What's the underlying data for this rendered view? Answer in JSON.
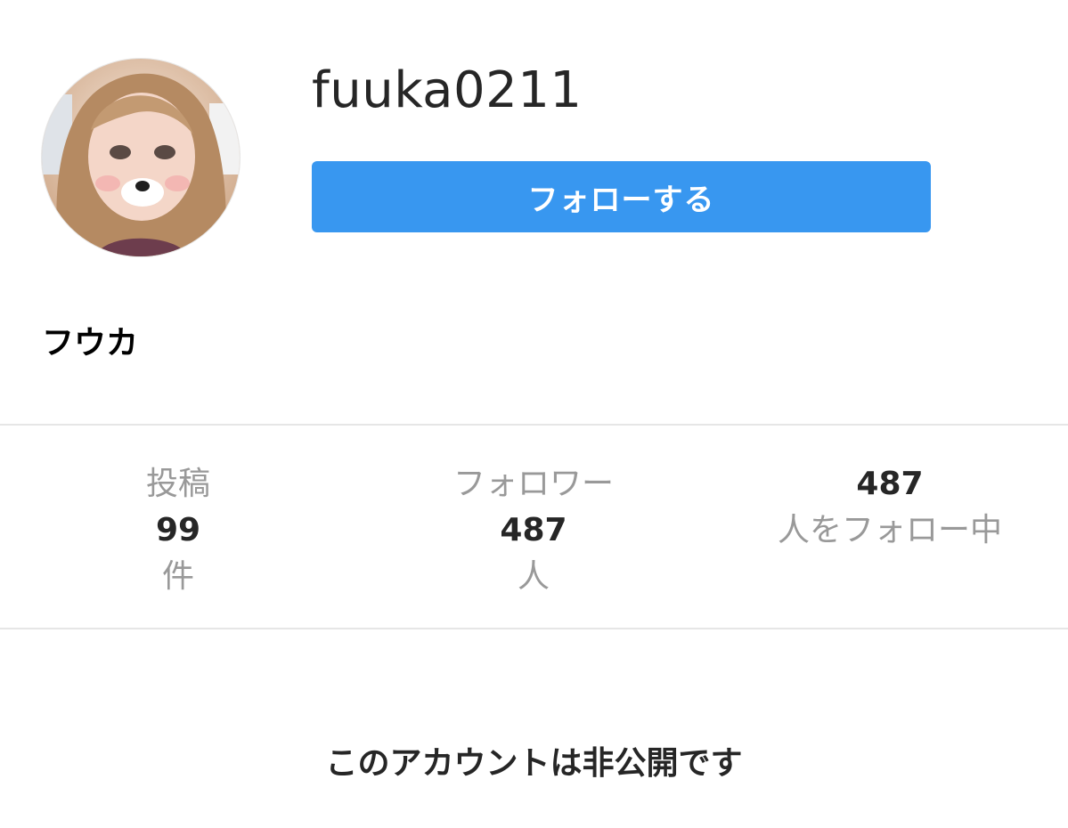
{
  "profile": {
    "username": "fuuka0211",
    "display_name": "フウカ",
    "avatar_icon": "profile-photo"
  },
  "actions": {
    "follow_label": "フォローする"
  },
  "stats": {
    "posts": {
      "label": "投稿",
      "count": "99",
      "unit": "件"
    },
    "followers": {
      "label": "フォロワー",
      "count": "487",
      "unit": "人"
    },
    "following": {
      "count": "487",
      "label": "人をフォロー中"
    }
  },
  "notice": {
    "private_text": "このアカウントは非公開です"
  },
  "colors": {
    "accent": "#3897f0",
    "text_primary": "#262626",
    "text_secondary": "#999999",
    "divider": "#e6e6e6"
  }
}
